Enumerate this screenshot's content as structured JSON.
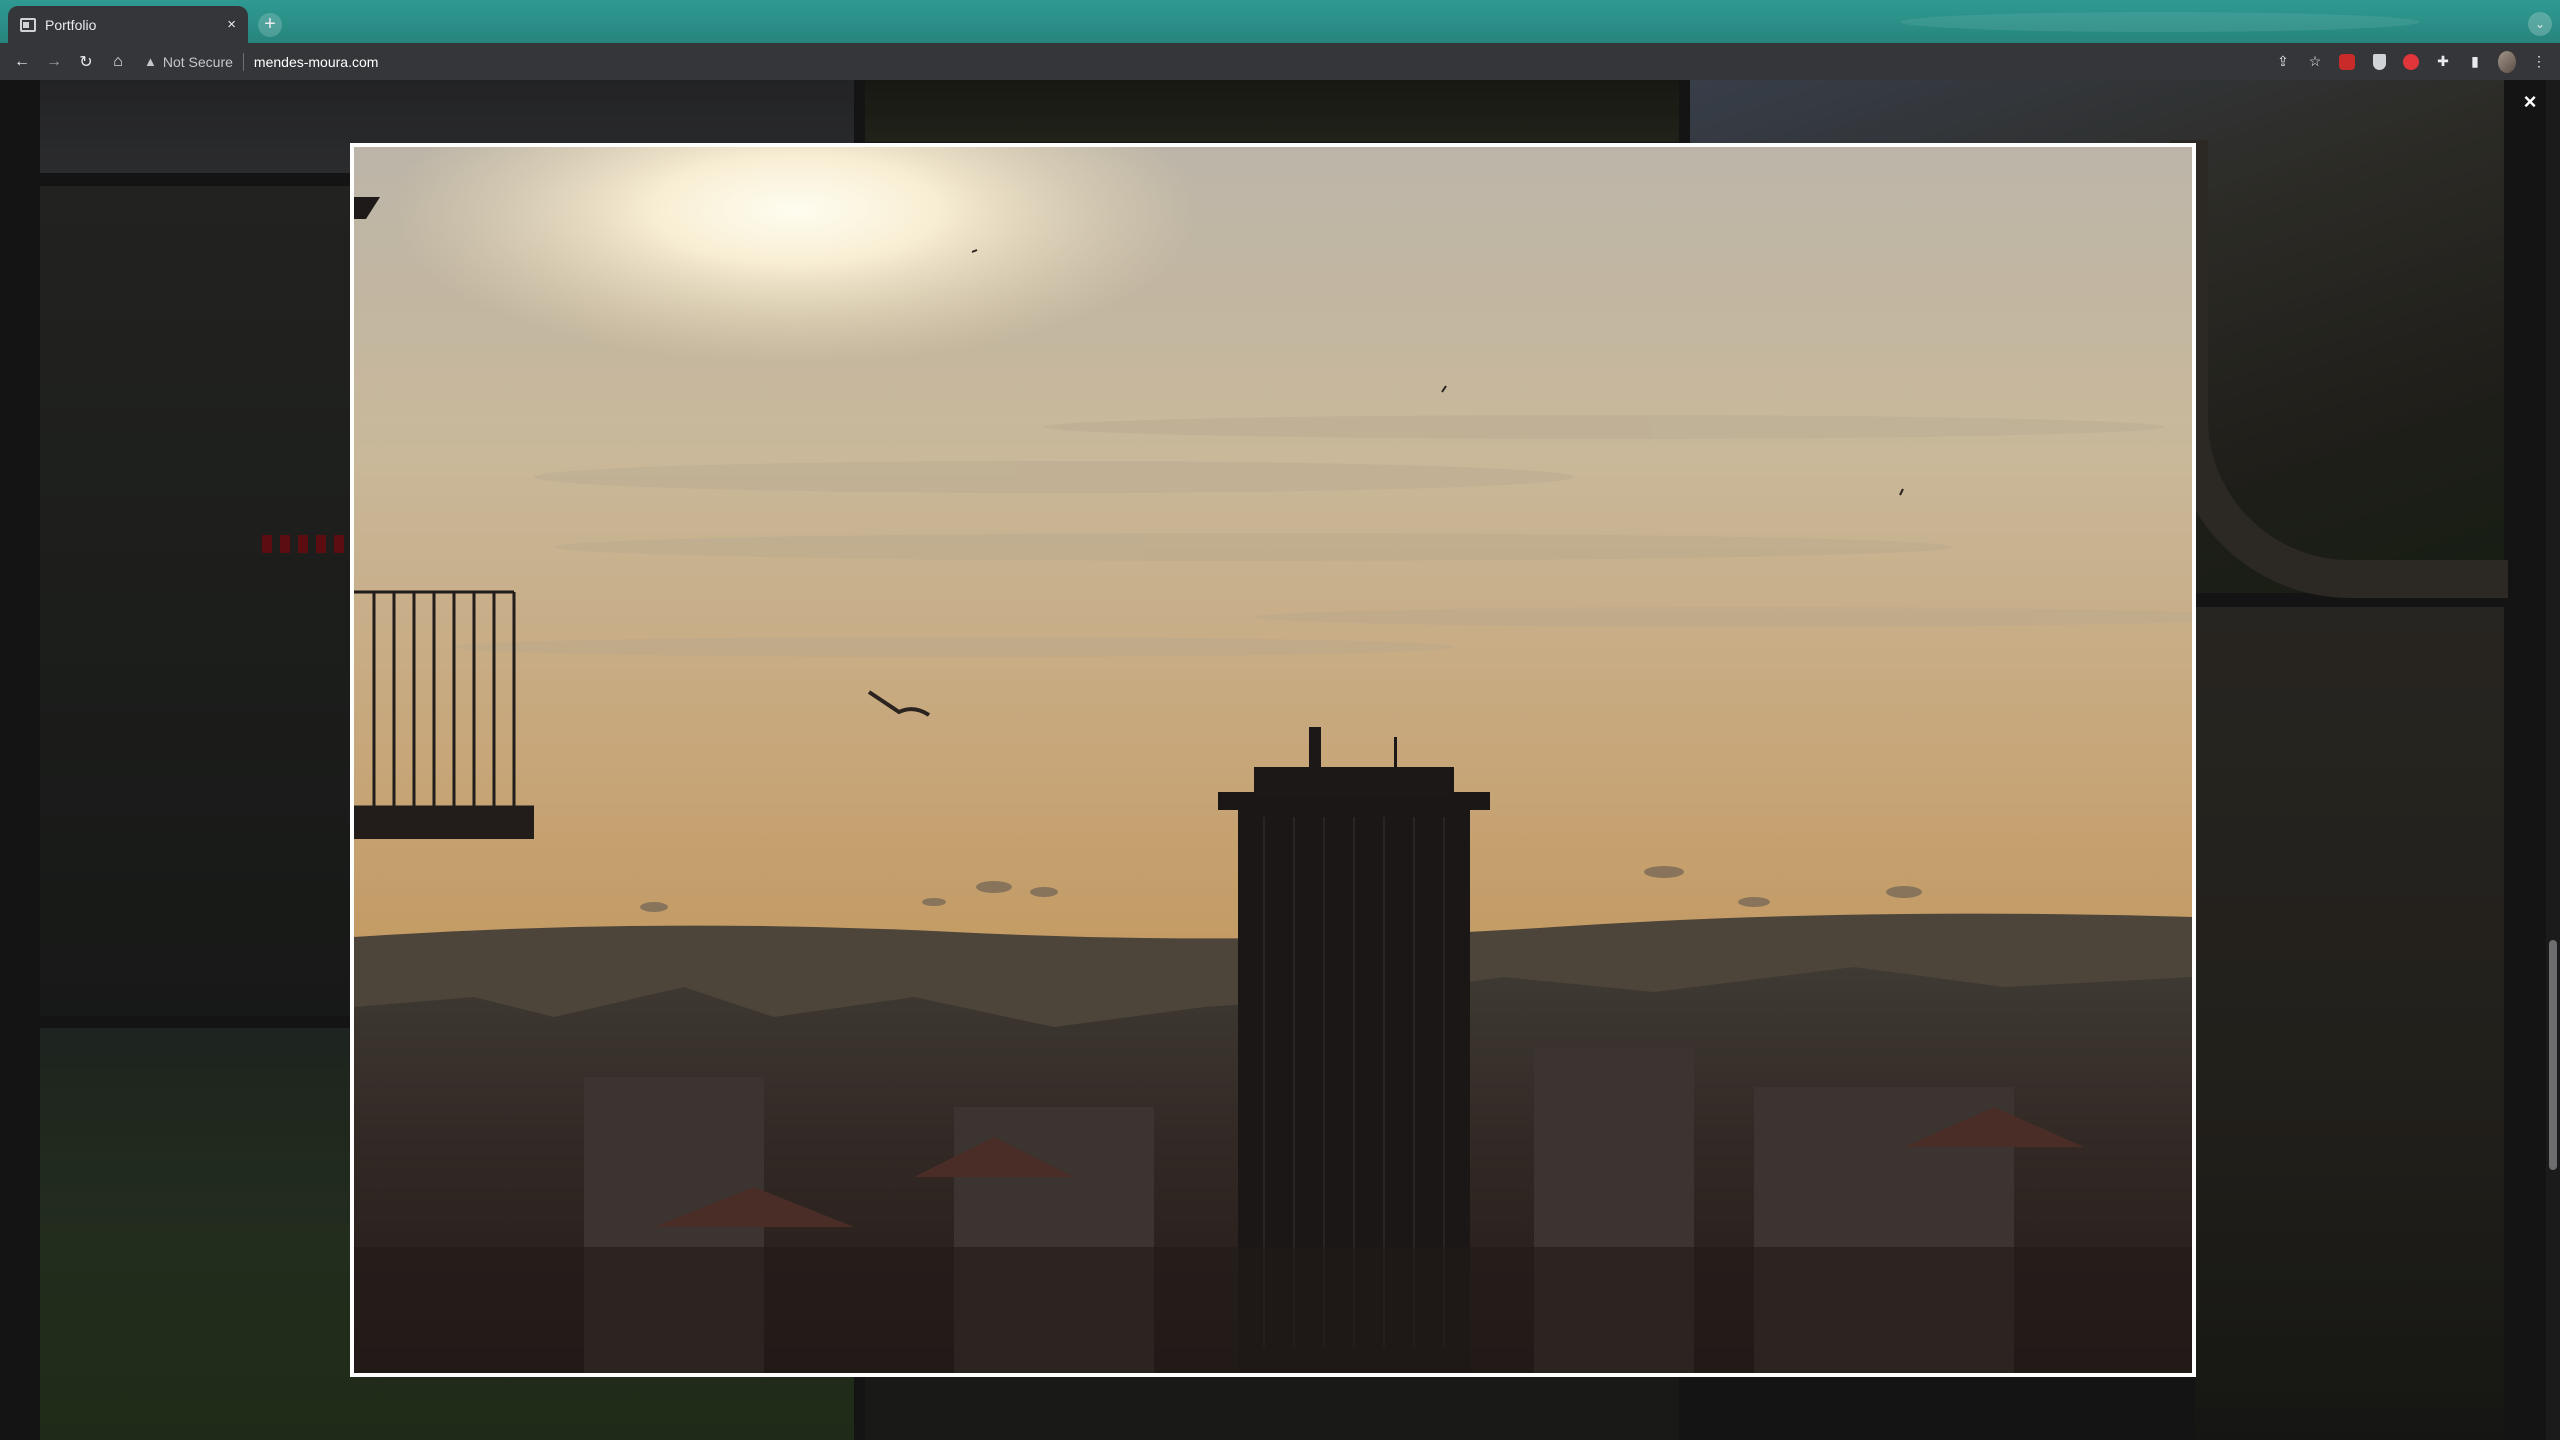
{
  "browser": {
    "tab": {
      "title": "Portfolio",
      "close": "×"
    },
    "new_tab": "+",
    "address": {
      "security_label": "Not Secure",
      "url": "mendes-moura.com"
    }
  },
  "lightbox": {
    "close_label": "×",
    "photo_icon": "sunset-city-photo"
  },
  "colors": {
    "tab_strip": "#2f9a92",
    "toolbar": "#35363a",
    "lightbox_frame": "#ffffff"
  }
}
